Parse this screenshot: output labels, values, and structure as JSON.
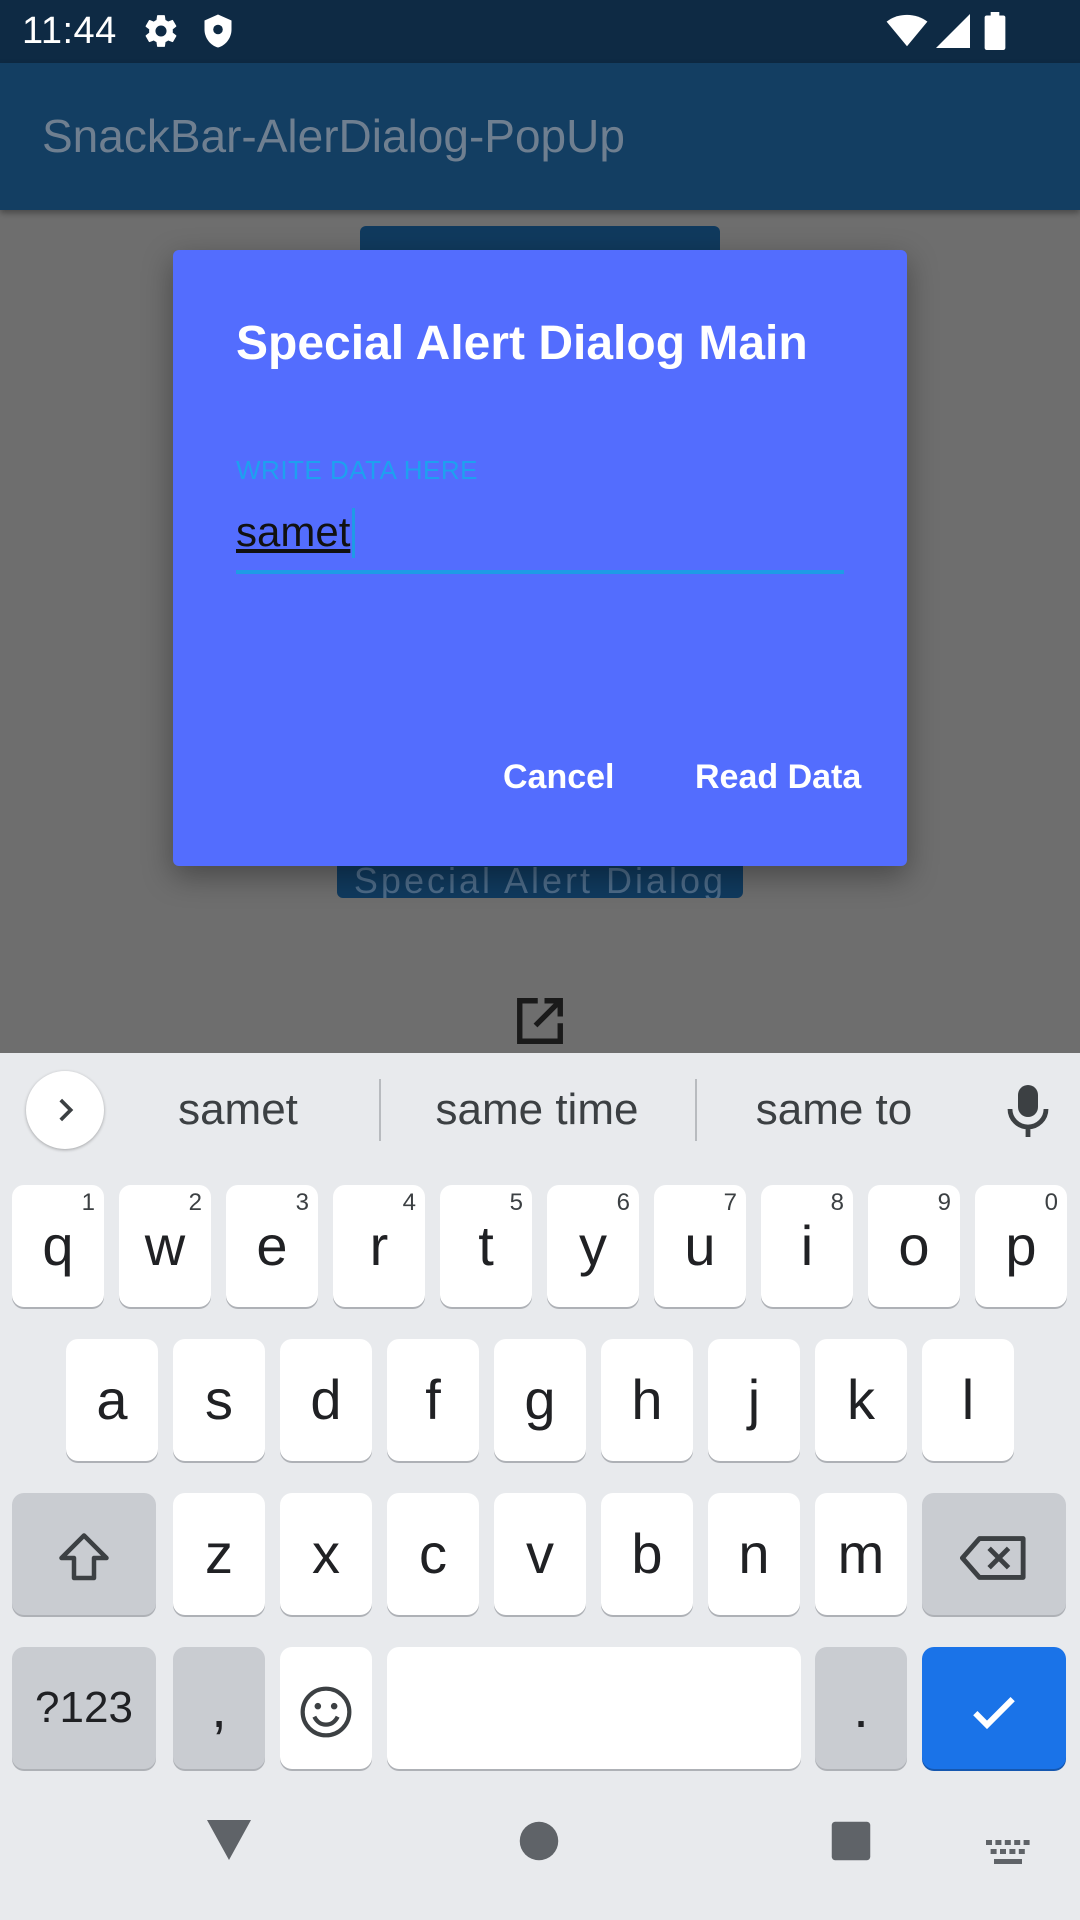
{
  "status_bar": {
    "time": "11:44"
  },
  "app_bar": {
    "title": "SnackBar-AlerDialog-PopUp"
  },
  "background": {
    "button_2_text": "Special Alert Dialog"
  },
  "dialog": {
    "title": "Special Alert Dialog Main",
    "field_label": "WRITE DATA HERE",
    "field_value": "samet",
    "cancel_label": "Cancel",
    "read_label": "Read Data"
  },
  "keyboard": {
    "suggestions": [
      "samet",
      "same time",
      "same to"
    ],
    "row1": [
      {
        "k": "q",
        "h": "1"
      },
      {
        "k": "w",
        "h": "2"
      },
      {
        "k": "e",
        "h": "3"
      },
      {
        "k": "r",
        "h": "4"
      },
      {
        "k": "t",
        "h": "5"
      },
      {
        "k": "y",
        "h": "6"
      },
      {
        "k": "u",
        "h": "7"
      },
      {
        "k": "i",
        "h": "8"
      },
      {
        "k": "o",
        "h": "9"
      },
      {
        "k": "p",
        "h": "0"
      }
    ],
    "row2": [
      "a",
      "s",
      "d",
      "f",
      "g",
      "h",
      "j",
      "k",
      "l"
    ],
    "row3": [
      "z",
      "x",
      "c",
      "v",
      "b",
      "n",
      "m"
    ],
    "symbols_label": "?123",
    "comma_label": ",",
    "period_label": "."
  },
  "colors": {
    "dialog_bg": "#536dfe",
    "accent": "#1e9be6",
    "enter_key": "#1a73e8"
  }
}
